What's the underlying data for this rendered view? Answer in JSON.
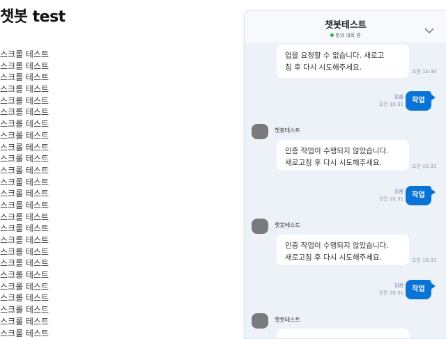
{
  "page": {
    "title": "챗봇 test",
    "scroll_lines": [
      "스크롤 테스트",
      "스크롤 테스트",
      "스크롤 테스트",
      "스크롤 테스트",
      "스크롤 테스트",
      "스크롤 테스트",
      "스크롤 테스트",
      "스크롤 테스트",
      "스크롤 테스트",
      "스크롤 테스트",
      "스크롤 테스트",
      "스크롤 테스트",
      "스크롤 테스트",
      "스크롤 테스트",
      "스크롤 테스트",
      "스크롤 테스트",
      "스크롤 테스트",
      "스크롤 테스트",
      "스크롤 테스트",
      "스크롤 테스트",
      "스크롤 테스트",
      "스크롤 테스트",
      "스크롤 테스트",
      "스크롤 테스트",
      "스크롤 테스트"
    ]
  },
  "chat": {
    "title": "챗봇테스트",
    "status": "봇과 대화 중",
    "collapse_icon": "chevron-down-icon",
    "colors": {
      "user_bubble": "#0a74d6",
      "status_dot": "#27b34a",
      "widget_bg": "#edf2f8"
    },
    "messages": [
      {
        "sender": "bot",
        "name": "",
        "text": "업을 요청할 수 없습니다. 새로고\n침 후 다시 시도해주세요.",
        "time": "오전 10:30"
      },
      {
        "sender": "user",
        "read": "읽음",
        "time": "오전 10:31",
        "text": "작업"
      },
      {
        "sender": "bot",
        "name": "챗봇테스트",
        "text": "인증 작업이 수행되지 않았습니다.\n새로고침 후 다시 시도해주세요.",
        "time": "오전 10:31"
      },
      {
        "sender": "user",
        "read": "읽음",
        "time": "오전 10:31",
        "text": "작업"
      },
      {
        "sender": "bot",
        "name": "챗봇테스트",
        "text": "인증 작업이 수행되지 않았습니다.\n새로고침 후 다시 시도해주세요.",
        "time": "오전 10:31"
      },
      {
        "sender": "user",
        "read": "읽음",
        "time": "오전 10:31",
        "text": "작업"
      },
      {
        "sender": "bot",
        "name": "챗봇테스트",
        "text": "",
        "time": ""
      }
    ]
  }
}
